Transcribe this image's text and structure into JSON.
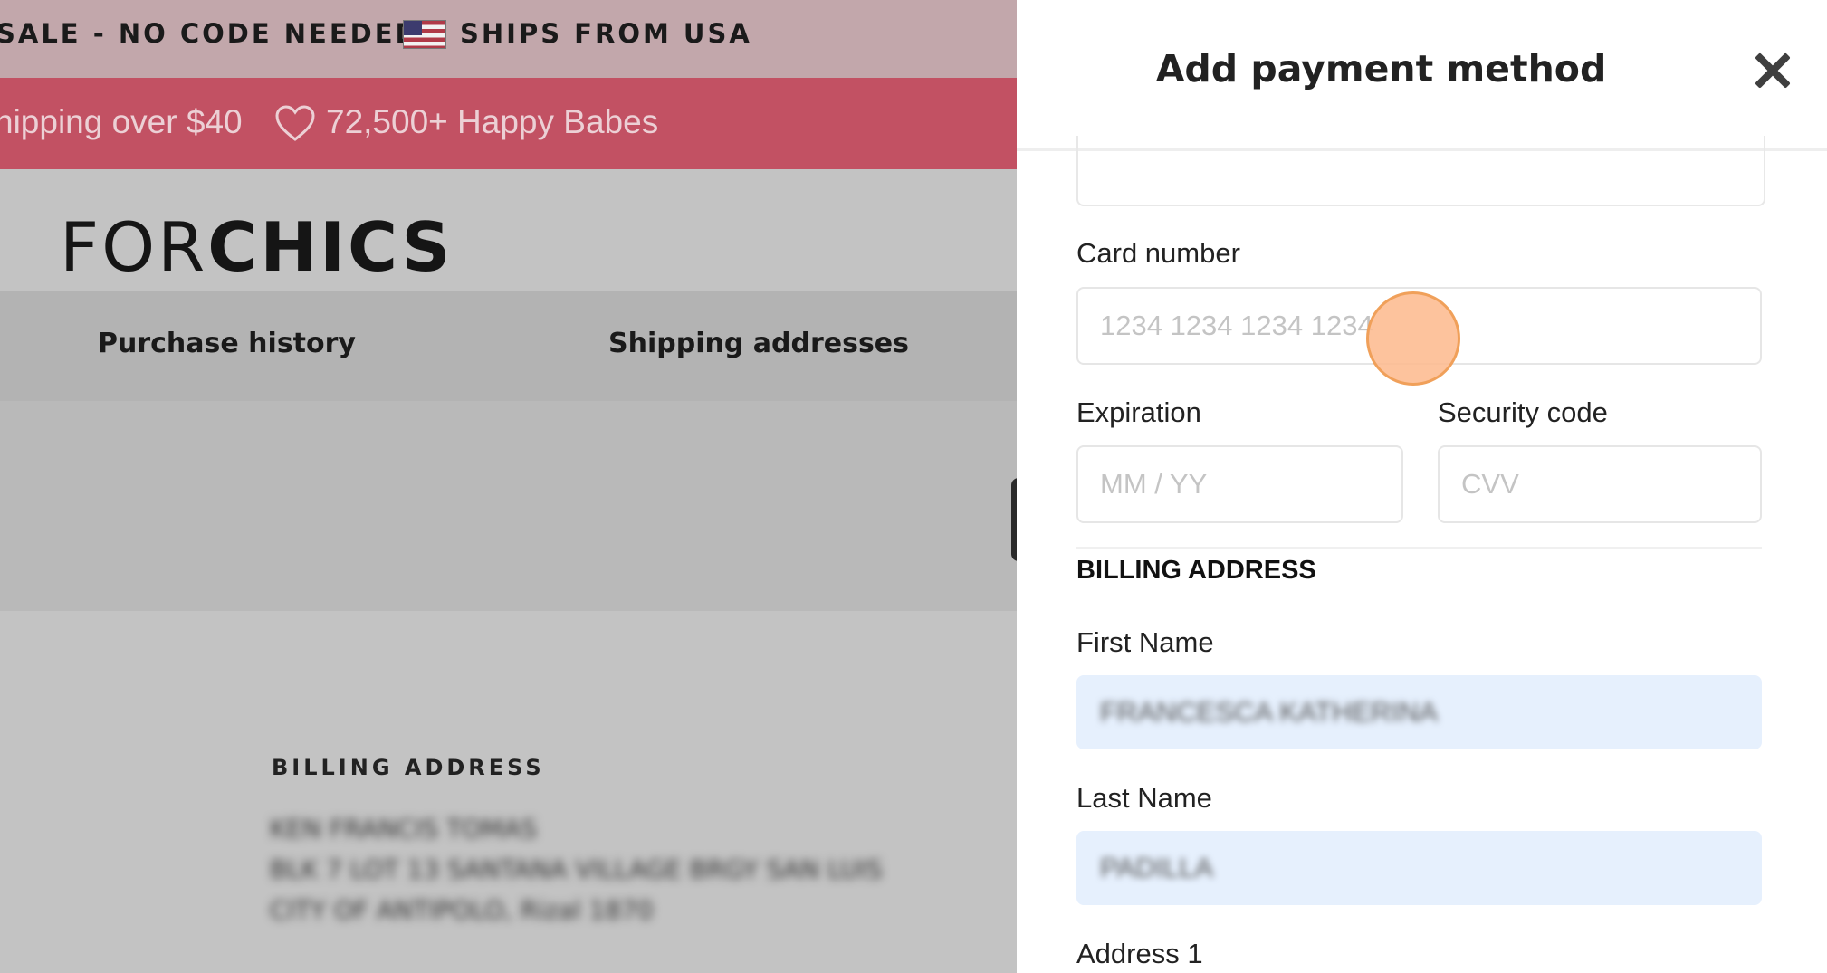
{
  "promo_bar": {
    "left_text": "SALE - NO CODE NEEDED",
    "right_text": "SHIPS FROM USA",
    "flag_icon": "us-flag-icon"
  },
  "announcement_bar": {
    "shipping_text": "hipping over $40",
    "happy_text": "72,500+ Happy Babes",
    "heart_icon": "heart-outline-icon"
  },
  "brand": {
    "logo_light": "FOR",
    "logo_bold": "CHICS"
  },
  "account_nav": {
    "purchase_history": "Purchase history",
    "shipping_addresses": "Shipping addresses"
  },
  "billing_card": {
    "title": "BILLING ADDRESS",
    "lines": [
      "KEN FRANCIS TOMAS",
      "BLK 7 LOT 13 SANTANA VILLAGE BRGY SAN LUIS",
      "CITY OF ANTIPOLO, Rizal 1870"
    ]
  },
  "modal": {
    "title": "Add payment method",
    "close_icon": "close-icon",
    "card_number": {
      "label": "Card number",
      "placeholder": "1234 1234 1234 1234",
      "value": ""
    },
    "expiration": {
      "label": "Expiration",
      "placeholder": "MM / YY"
    },
    "security_code": {
      "label": "Security code",
      "placeholder": "CVV"
    },
    "billing_section_title": "BILLING ADDRESS",
    "first_name": {
      "label": "First Name",
      "value": "FRANCESCA KATHERINA"
    },
    "last_name": {
      "label": "Last Name",
      "value": "PADILLA"
    },
    "address1": {
      "label": "Address 1"
    }
  },
  "colors": {
    "promo_bg": "#c2a7ab",
    "announcement_bg": "#c25163",
    "overlay_bg": "#c3c3c3",
    "filled_input_bg": "#e6f0fd",
    "click_marker": "#fdb98c"
  }
}
